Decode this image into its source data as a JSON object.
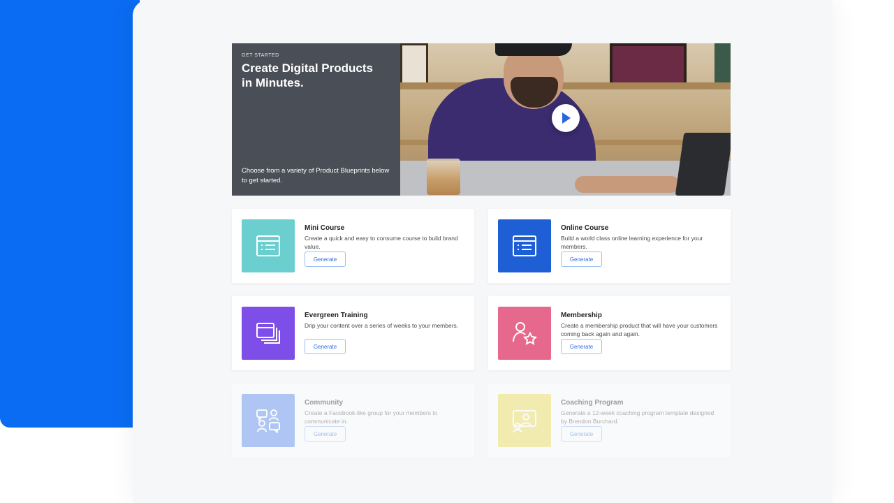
{
  "hero": {
    "eyebrow": "GET STARTED",
    "title_line1": "Create Digital Products",
    "title_line2": "in Minutes.",
    "description": "Choose from a variety of Product Blueprints below to get started."
  },
  "cards": [
    {
      "title": "Mini Course",
      "description": "Create a quick and easy to consume course to build brand value.",
      "button": "Generate",
      "color": "#6ccfcf",
      "icon": "course-list-icon"
    },
    {
      "title": "Online Course",
      "description": "Build a world class online learning experience for your members.",
      "button": "Generate",
      "color": "#1f5fd6",
      "icon": "course-list-icon"
    },
    {
      "title": "Evergreen Training",
      "description": "Drip your content over a series of weeks to your members.",
      "button": "Generate",
      "color": "#7d4fe8",
      "icon": "stacked-windows-icon"
    },
    {
      "title": "Membership",
      "description": "Create a membership product that will have your customers coming back again and again.",
      "button": "Generate",
      "color": "#e6688c",
      "icon": "member-star-icon"
    },
    {
      "title": "Community",
      "description": "Create a Facebook-like group for your members to communicate in.",
      "button": "Generate",
      "color": "#4f84f0",
      "icon": "community-chat-icon"
    },
    {
      "title": "Coaching Program",
      "description": "Generate a 12-week coaching program template designed by Brendon Burchard.",
      "button": "Generate",
      "color": "#eedc4a",
      "icon": "coaching-board-icon"
    }
  ]
}
